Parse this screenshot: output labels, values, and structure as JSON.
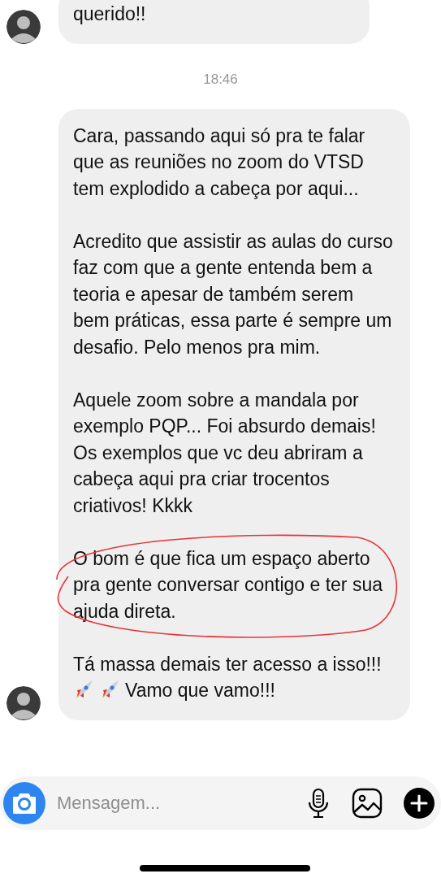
{
  "messages": [
    {
      "kind": "incoming",
      "paragraphs": [
        {
          "text": "querido!!"
        }
      ]
    },
    {
      "kind": "timestamp",
      "text": "18:46"
    },
    {
      "kind": "incoming",
      "paragraphs": [
        {
          "text": "Cara, passando aqui só pra te falar que as reuniões no zoom do VTSD tem explodido a cabeça por aqui..."
        },
        {
          "text": "Acredito que assistir as aulas do curso faz com que a gente entenda bem a teoria e apesar de também serem bem práticas, essa parte é sempre um desafio. Pelo menos pra mim."
        },
        {
          "text": "Aquele zoom sobre a mandala por exemplo PQP... Foi absurdo demais! Os exemplos que vc deu abriram a cabeça aqui pra criar trocentos criativos! Kkkk"
        },
        {
          "text": "O bom é que fica um espaço aberto pra gente conversar contigo e ter sua ajuda direta.",
          "circled": true
        },
        {
          "text": "Tá massa demais ter acesso a isso!!!",
          "text_after": "Vamo que vamo!!!"
        }
      ]
    }
  ],
  "composer": {
    "placeholder": "Mensagem..."
  }
}
